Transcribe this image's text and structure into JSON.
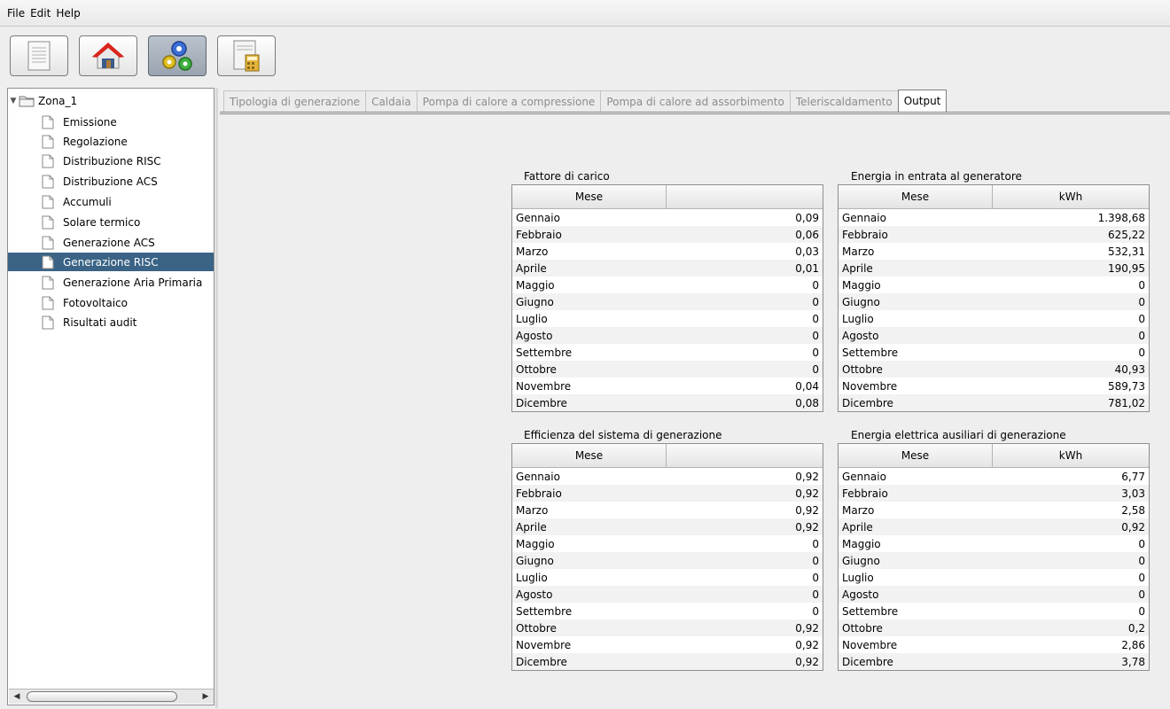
{
  "menu": {
    "items": [
      "File",
      "Edit",
      "Help"
    ]
  },
  "toolbar": {
    "buttons": [
      {
        "name": "document-icon"
      },
      {
        "name": "home-icon"
      },
      {
        "name": "gears-icon",
        "active": true
      },
      {
        "name": "calculator-sheet-icon"
      }
    ]
  },
  "sidebar": {
    "root": "Zona_1",
    "items": [
      {
        "label": "Emissione"
      },
      {
        "label": "Regolazione"
      },
      {
        "label": "Distribuzione RISC"
      },
      {
        "label": "Distribuzione ACS"
      },
      {
        "label": "Accumuli"
      },
      {
        "label": "Solare termico"
      },
      {
        "label": "Generazione ACS"
      },
      {
        "label": "Generazione RISC",
        "selected": true
      },
      {
        "label": "Generazione Aria Primaria"
      },
      {
        "label": "Fotovoltaico"
      },
      {
        "label": "Risultati audit"
      }
    ]
  },
  "tabs": [
    {
      "label": "Tipologia di generazione"
    },
    {
      "label": "Caldaia"
    },
    {
      "label": "Pompa di calore a compressione"
    },
    {
      "label": "Pompa di calore ad assorbimento"
    },
    {
      "label": "Teleriscaldamento"
    },
    {
      "label": "Output",
      "active": true
    }
  ],
  "tables": [
    {
      "title": "Fattore di carico",
      "col1": "Mese",
      "col2": "",
      "rows": [
        [
          "Gennaio",
          "0,09"
        ],
        [
          "Febbraio",
          "0,06"
        ],
        [
          "Marzo",
          "0,03"
        ],
        [
          "Aprile",
          "0,01"
        ],
        [
          "Maggio",
          "0"
        ],
        [
          "Giugno",
          "0"
        ],
        [
          "Luglio",
          "0"
        ],
        [
          "Agosto",
          "0"
        ],
        [
          "Settembre",
          "0"
        ],
        [
          "Ottobre",
          "0"
        ],
        [
          "Novembre",
          "0,04"
        ],
        [
          "Dicembre",
          "0,08"
        ]
      ]
    },
    {
      "title": "Energia in entrata al generatore",
      "col1": "Mese",
      "col2": "kWh",
      "rows": [
        [
          "Gennaio",
          "1.398,68"
        ],
        [
          "Febbraio",
          "625,22"
        ],
        [
          "Marzo",
          "532,31"
        ],
        [
          "Aprile",
          "190,95"
        ],
        [
          "Maggio",
          "0"
        ],
        [
          "Giugno",
          "0"
        ],
        [
          "Luglio",
          "0"
        ],
        [
          "Agosto",
          "0"
        ],
        [
          "Settembre",
          "0"
        ],
        [
          "Ottobre",
          "40,93"
        ],
        [
          "Novembre",
          "589,73"
        ],
        [
          "Dicembre",
          "781,02"
        ]
      ]
    },
    {
      "title": "Efficienza del sistema di generazione",
      "col1": "Mese",
      "col2": "",
      "rows": [
        [
          "Gennaio",
          "0,92"
        ],
        [
          "Febbraio",
          "0,92"
        ],
        [
          "Marzo",
          "0,92"
        ],
        [
          "Aprile",
          "0,92"
        ],
        [
          "Maggio",
          "0"
        ],
        [
          "Giugno",
          "0"
        ],
        [
          "Luglio",
          "0"
        ],
        [
          "Agosto",
          "0"
        ],
        [
          "Settembre",
          "0"
        ],
        [
          "Ottobre",
          "0,92"
        ],
        [
          "Novembre",
          "0,92"
        ],
        [
          "Dicembre",
          "0,92"
        ]
      ]
    },
    {
      "title": "Energia elettrica ausiliari di generazione",
      "col1": "Mese",
      "col2": "kWh",
      "rows": [
        [
          "Gennaio",
          "6,77"
        ],
        [
          "Febbraio",
          "3,03"
        ],
        [
          "Marzo",
          "2,58"
        ],
        [
          "Aprile",
          "0,92"
        ],
        [
          "Maggio",
          "0"
        ],
        [
          "Giugno",
          "0"
        ],
        [
          "Luglio",
          "0"
        ],
        [
          "Agosto",
          "0"
        ],
        [
          "Settembre",
          "0"
        ],
        [
          "Ottobre",
          "0,2"
        ],
        [
          "Novembre",
          "2,86"
        ],
        [
          "Dicembre",
          "3,78"
        ]
      ]
    }
  ],
  "colors": {
    "selection": "#3a6385",
    "background": "#eeeeee"
  }
}
